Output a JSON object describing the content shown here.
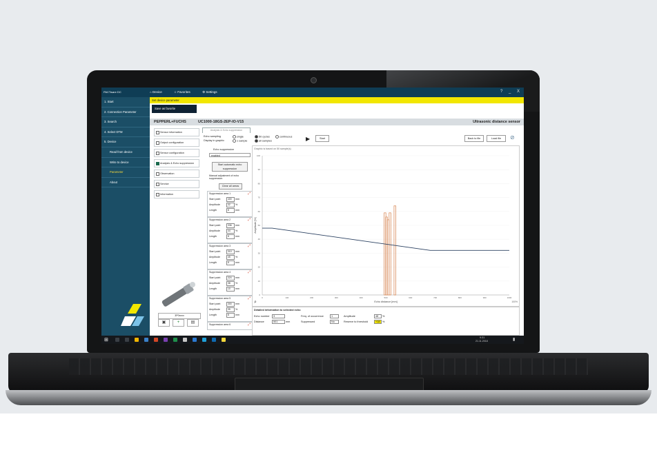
{
  "titlebar": {
    "app_name": "PACTware DC",
    "nav": [
      "Device",
      "Favorites",
      "Settings"
    ],
    "window_controls": [
      "?",
      "_",
      "X"
    ]
  },
  "sidebar": {
    "items": [
      {
        "label": "1. Start",
        "indent": false,
        "active": false
      },
      {
        "label": "2. Connection Parameter",
        "indent": false,
        "active": false
      },
      {
        "label": "3. Search",
        "indent": false,
        "active": false
      },
      {
        "label": "4. Select DTM",
        "indent": false,
        "active": false
      },
      {
        "label": "5. Device",
        "indent": false,
        "active": false
      },
      {
        "label": "Read from device",
        "indent": true,
        "active": false
      },
      {
        "label": "Write to device",
        "indent": true,
        "active": false
      },
      {
        "label": "Parameter",
        "indent": true,
        "active": true
      },
      {
        "label": "About",
        "indent": true,
        "active": false
      }
    ],
    "brand": "PACTware DC"
  },
  "banner": {
    "text": "Set device parameter"
  },
  "save_button": "Save as favorite",
  "device": {
    "brand": "PEPPERL+FUCHS",
    "model": "UC1000-18GS-2EP-IO-V15",
    "type": "Ultrasonic distance sensor"
  },
  "menu": [
    {
      "label": "Sensor information",
      "selected": false
    },
    {
      "label": "Output configuration",
      "selected": false
    },
    {
      "label": "Sensor configuration",
      "selected": false
    },
    {
      "label": "Analysis & Echo suppression",
      "selected": true
    },
    {
      "label": "Observation",
      "selected": false
    },
    {
      "label": "Service",
      "selected": false
    },
    {
      "label": "Information",
      "selected": false
    }
  ],
  "sensor_label": "3P0xxxx",
  "tab": "Analysis & Echo suppression",
  "controls": {
    "echo_sampling_label": "Echo sampling",
    "display_label": "Display in graphic",
    "single": "single",
    "continuous": "continuous",
    "cycles": "50 cycles",
    "one_sample": "1 sample",
    "all_samples": "all samples",
    "start": "Start",
    "back_to_file": "Back to file",
    "load_file": "Load file"
  },
  "suppression": {
    "label": "Echo suppression",
    "value": "enabled",
    "auto_button": "Start automatic echo suppression",
    "manual_label": "Manual adjustment of echo suppression",
    "clear_button": "Clear all areas",
    "areas": [
      {
        "name": "Suppression area 1",
        "start": "400",
        "amplitude": "32",
        "length": "8"
      },
      {
        "name": "Suppression area 2",
        "start": "336",
        "amplitude": "44",
        "length": "8"
      },
      {
        "name": "Suppression area 3",
        "start": "310",
        "amplitude": "45",
        "length": "8"
      },
      {
        "name": "Suppression area 4",
        "start": "324",
        "amplitude": "38",
        "length": "10"
      },
      {
        "name": "Suppression area 5",
        "start": "300",
        "amplitude": "35",
        "length": "8"
      }
    ],
    "area6": "Suppression area 6",
    "start_label": "Start point",
    "amp_label": "Amplitude",
    "len_label": "Length",
    "unit_mm": "mm",
    "unit_pct": "%"
  },
  "chart_data": {
    "type": "line",
    "title": "Graphic is based on 50 sample(s)",
    "xlabel": "Echo distance [mm]",
    "ylabel": "Amplitude [%]",
    "xlim": [
      0,
      1000
    ],
    "ylim": [
      0,
      100
    ],
    "series": [
      {
        "name": "threshold",
        "points": [
          [
            0,
            48
          ],
          [
            40,
            48
          ],
          [
            680,
            32
          ],
          [
            1000,
            32
          ]
        ]
      }
    ],
    "bars": [
      {
        "x": 497,
        "height": 59
      },
      {
        "x": 503,
        "height": 56
      },
      {
        "x": 510,
        "height": 54
      },
      {
        "x": 517,
        "height": 59
      },
      {
        "x": 537,
        "height": 64
      }
    ],
    "zoom_label": "100%"
  },
  "details": {
    "title": "Detailed information to selected echo",
    "echo_number_label": "Echo number",
    "echo_number": "3",
    "distance_label": "Distance",
    "distance": "501",
    "distance_unit": "mm",
    "freq_label": "Freq. of occurrence",
    "freq": "1",
    "suppressed_label": "Suppressed",
    "suppressed": "No",
    "amplitude_label": "Amplitude",
    "amplitude": "48",
    "reserve_label": "Reserve to threshold",
    "reserve": "+18",
    "pct": "%"
  },
  "status": {
    "connected": "Connected",
    "database": "Database"
  },
  "taskbar": {
    "time": "9:31",
    "date": "21.11.2018"
  },
  "colors": {
    "brand_dark": "#0f3d55",
    "sidebar": "#1b4e66",
    "banner": "#f2e600",
    "threshold": "#2a4060",
    "echo": "#d98c5c"
  }
}
